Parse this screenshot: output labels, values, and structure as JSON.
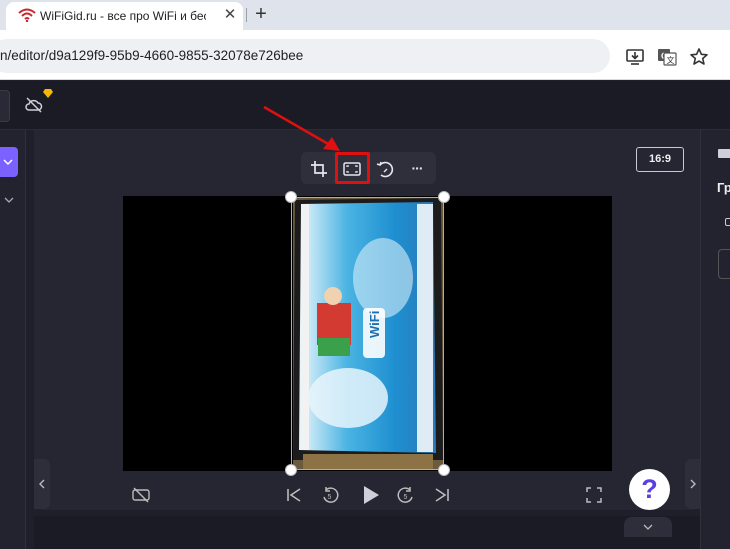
{
  "browser": {
    "tab_title": "WiFiGid.ru - все про WiFi и бес",
    "tab_close": "✕",
    "new_tab": "+",
    "url": "n/editor/d9a129f9-95b9-4660-9855-32078e726bee"
  },
  "editor": {
    "aspect_ratio": "16:9",
    "help_label": "?",
    "accent_color": "#7b61ff",
    "selection_color": "#68d2a7",
    "highlight_color": "#e01010"
  },
  "toolbar": {
    "items": [
      "crop-icon",
      "fit-icon",
      "rotate-icon",
      "more-icon"
    ],
    "more_label": "···"
  },
  "right_panel": {
    "heading_fragment": "Гр"
  }
}
